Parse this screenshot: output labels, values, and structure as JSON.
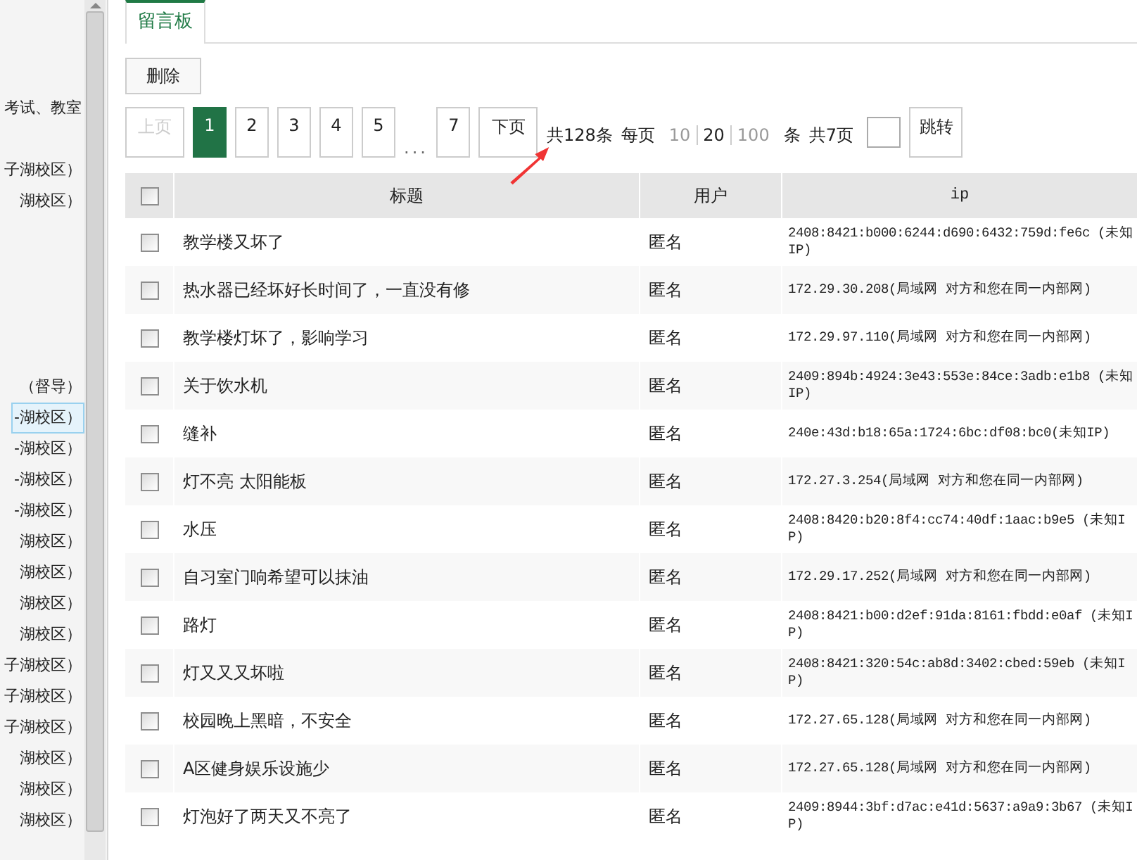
{
  "sidebar": {
    "items": [
      {
        "label": "考试、教室",
        "selected": false
      },
      {
        "label": "子湖校区）",
        "selected": false
      },
      {
        "label": "湖校区）",
        "selected": false
      },
      {
        "label": "（督导）",
        "selected": false
      },
      {
        "label": "-湖校区）",
        "selected": true
      },
      {
        "label": "-湖校区）",
        "selected": false
      },
      {
        "label": "-湖校区）",
        "selected": false
      },
      {
        "label": "-湖校区）",
        "selected": false
      },
      {
        "label": "湖校区）",
        "selected": false
      },
      {
        "label": "湖校区）",
        "selected": false
      },
      {
        "label": "湖校区）",
        "selected": false
      },
      {
        "label": "湖校区）",
        "selected": false
      },
      {
        "label": "子湖校区）",
        "selected": false
      },
      {
        "label": "子湖校区）",
        "selected": false
      },
      {
        "label": "子湖校区）",
        "selected": false
      },
      {
        "label": "湖校区）",
        "selected": false
      },
      {
        "label": "湖校区）",
        "selected": false
      },
      {
        "label": "湖校区）",
        "selected": false
      }
    ]
  },
  "tabs": [
    {
      "label": "留言板",
      "selected": true
    }
  ],
  "toolbar": {
    "delete_button": "删除"
  },
  "pagination": {
    "prev": {
      "label": "上页",
      "disabled": true
    },
    "pages": [
      {
        "label": "1",
        "selected": true,
        "kind": "page"
      },
      {
        "label": "2",
        "selected": false,
        "kind": "page"
      },
      {
        "label": "3",
        "selected": false,
        "kind": "page"
      },
      {
        "label": "4",
        "selected": false,
        "kind": "page"
      },
      {
        "label": "5",
        "selected": false,
        "kind": "page"
      },
      {
        "label": "...",
        "kind": "ellipsis"
      },
      {
        "label": "7",
        "selected": false,
        "kind": "page"
      }
    ],
    "next": {
      "label": "下页",
      "disabled": false
    },
    "total": "共128条",
    "per_page_label": "每页",
    "per_page_options": [
      {
        "label": "10",
        "selected": false
      },
      {
        "label": "20",
        "selected": true
      },
      {
        "label": "100",
        "selected": false
      }
    ],
    "per_page_unit": "条",
    "page_count": "共7页",
    "jump_button": "跳转"
  },
  "table": {
    "header_checked": false,
    "columns": [
      "标题",
      "用户",
      "ip"
    ],
    "rows": [
      {
        "checked": false,
        "title": "教学楼又坏了",
        "user": "匿名",
        "ip": "2408:8421:b000:6244:d690:6432:759d:fe6c (未知IP)"
      },
      {
        "checked": false,
        "title": "热水器已经坏好长时间了，一直没有修",
        "user": "匿名",
        "ip": "172.29.30.208(局域网 对方和您在同一内部网)"
      },
      {
        "checked": false,
        "title": "教学楼灯坏了，影响学习",
        "user": "匿名",
        "ip": "172.29.97.110(局域网 对方和您在同一内部网)"
      },
      {
        "checked": false,
        "title": "关于饮水机",
        "user": "匿名",
        "ip": "2409:894b:4924:3e43:553e:84ce:3adb:e1b8 (未知IP)"
      },
      {
        "checked": false,
        "title": "缝补",
        "user": "匿名",
        "ip": "240e:43d:b18:65a:1724:6bc:df08:bc0(未知IP)"
      },
      {
        "checked": false,
        "title": "灯不亮 太阳能板",
        "user": "匿名",
        "ip": "172.27.3.254(局域网 对方和您在同一内部网)"
      },
      {
        "checked": false,
        "title": "水压",
        "user": "匿名",
        "ip": "2408:8420:b20:8f4:cc74:40df:1aac:b9e5 (未知IP)"
      },
      {
        "checked": false,
        "title": "自习室门响希望可以抹油",
        "user": "匿名",
        "ip": "172.29.17.252(局域网 对方和您在同一内部网)"
      },
      {
        "checked": false,
        "title": "路灯",
        "user": "匿名",
        "ip": "2408:8421:b00:d2ef:91da:8161:fbdd:e0af (未知IP)"
      },
      {
        "checked": false,
        "title": "灯又又又坏啦",
        "user": "匿名",
        "ip": "2408:8421:320:54c:ab8d:3402:cbed:59eb (未知IP)"
      },
      {
        "checked": false,
        "title": "校园晚上黑暗，不安全",
        "user": "匿名",
        "ip": "172.27.65.128(局域网 对方和您在同一内部网)"
      },
      {
        "checked": false,
        "title": "A区健身娱乐设施少",
        "user": "匿名",
        "ip": "172.27.65.128(局域网 对方和您在同一内部网)"
      },
      {
        "checked": false,
        "title": "灯泡好了两天又不亮了",
        "user": "匿名",
        "ip": "2409:8944:3bf:d7ac:e41d:5637:a9a9:3b67 (未知IP)"
      }
    ]
  }
}
